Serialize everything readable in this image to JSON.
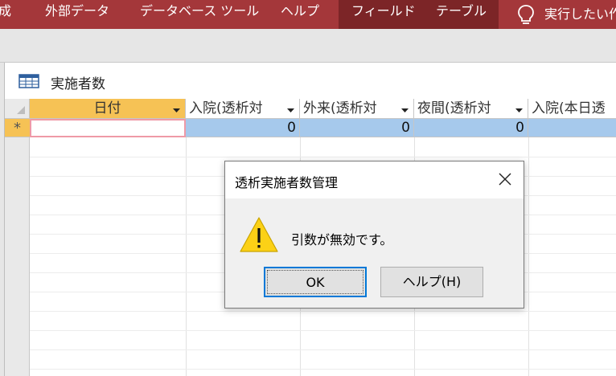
{
  "ribbon": {
    "tabs": [
      "成",
      "外部データ",
      "データベース ツール",
      "ヘルプ",
      "フィールド",
      "テーブル",
      "実行したい作"
    ]
  },
  "document": {
    "title": "実施者数",
    "columns": [
      "日付",
      "入院(透析対",
      "外来(透析対",
      "夜間(透析対",
      "入院(本日透"
    ],
    "new_row_marker": "*",
    "new_row_values": [
      "",
      "0",
      "0",
      "0",
      ""
    ]
  },
  "dialog": {
    "title": "透析実施者数管理",
    "message": "引数が無効です。",
    "ok_label": "OK",
    "help_label": "ヘルプ(H)",
    "icon": "warning-icon"
  },
  "colors": {
    "ribbon": "#a4373a",
    "context_tab": "#7c2527",
    "selected_header": "#f6c255",
    "row_highlight": "#a6c9ec"
  }
}
